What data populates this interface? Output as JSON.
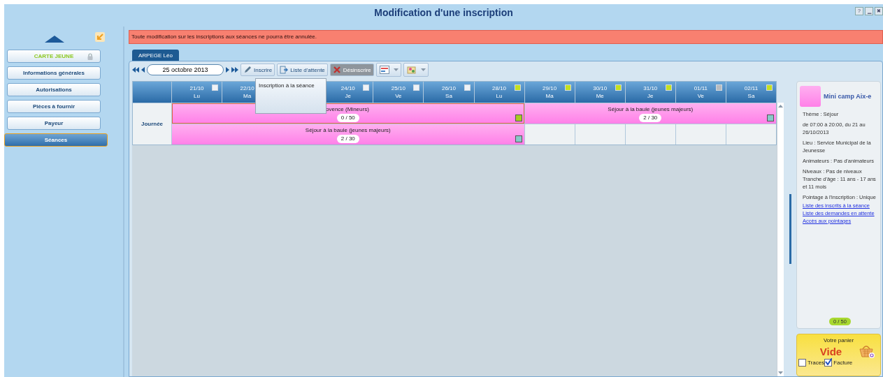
{
  "window": {
    "title": "Modification d'une inscription",
    "buttons": [
      "?",
      "▁",
      "✖"
    ]
  },
  "sidebar": {
    "items": [
      {
        "label": "CARTE JEUNE",
        "kind": "card",
        "locked": true,
        "selected": false
      },
      {
        "label": "Informations générales",
        "kind": "section",
        "locked": false,
        "selected": false
      },
      {
        "label": "Autorisations",
        "kind": "section",
        "locked": false,
        "selected": false
      },
      {
        "label": "Pièces à fournir",
        "kind": "section",
        "locked": false,
        "selected": false
      },
      {
        "label": "Payeur",
        "kind": "section",
        "locked": false,
        "selected": false
      },
      {
        "label": "Séances",
        "kind": "section",
        "locked": false,
        "selected": true
      }
    ]
  },
  "warning": "Toute modification sur les inscriptions aux séances ne pourra être annulée.",
  "tabs": [
    {
      "label": "ARPEGE Léo",
      "selected": true
    }
  ],
  "toolbar": {
    "date": "25 octobre 2013",
    "buttons": [
      {
        "label": "Inscrire",
        "kind": "pencil",
        "disabled": false
      },
      {
        "label": "Liste d'attente",
        "kind": "list",
        "disabled": false
      },
      {
        "label": "Désinscrire",
        "kind": "cross",
        "disabled": true
      }
    ],
    "tooltip": "Inscription à la séance"
  },
  "calendar": {
    "row_label": "Journée",
    "days": [
      {
        "date": "21/10",
        "day": "Lu",
        "color": "#eef2f6"
      },
      {
        "date": "22/10",
        "day": "Ma"
      },
      {
        "date": "24/10",
        "day": "Je",
        "color": "#eef2f6"
      },
      {
        "date": "25/10",
        "day": "Ve",
        "color": "#eef2f6"
      },
      {
        "date": "26/10",
        "day": "Sa",
        "color": "#eef2f6"
      },
      {
        "date": "28/10",
        "day": "Lu",
        "color": "#c4e020"
      },
      {
        "date": "29/10",
        "day": "Ma",
        "color": "#c4e020"
      },
      {
        "date": "30/10",
        "day": "Me",
        "color": "#c4e020"
      },
      {
        "date": "31/10",
        "day": "Je",
        "color": "#c4e020"
      },
      {
        "date": "01/11",
        "day": "Ve",
        "color": "#b8bcc0"
      },
      {
        "date": "02/11",
        "day": "Sa",
        "color": "#c4e020"
      }
    ],
    "lanes": [
      [
        {
          "title": "ovence (Mineurs)",
          "count": "0 / 50",
          "selected": true,
          "partly_covered": true,
          "color": "#a8cc20"
        },
        {
          "title": "Séjour à la baule (jeunes majeurs)",
          "count": "2 / 30",
          "selected": false,
          "partly_covered": false,
          "color": "#88c8c8"
        }
      ],
      [
        {
          "title": "Séjour à la baule (jeunes majeurs)",
          "count": "2 / 30",
          "selected": false,
          "partly_covered": false,
          "color": "#88c8c8"
        }
      ]
    ]
  },
  "details": {
    "title": "Mini camp Aix-e",
    "lines": [
      "Thème : Séjour",
      "de 07:00 à 20:00, du 21 au 26/10/2013",
      "Lieu : Service Municipal de la Jeunesse",
      "Animateurs : Pas d'animateurs",
      "Niveaux : Pas de niveaux\nTranche d'âge : 11 ans - 17 ans et 11 mois",
      "Pointage à l'inscription : Unique"
    ],
    "links": [
      "Liste des inscrits à la séance",
      "Liste des demandes en attente",
      "Accès aux pointages"
    ],
    "count": "0 / 50"
  },
  "cart": {
    "title": "Votre panier",
    "status": "Vide",
    "options": [
      {
        "label": "Traces",
        "checked": false
      },
      {
        "label": "Facture",
        "checked": true
      }
    ]
  }
}
